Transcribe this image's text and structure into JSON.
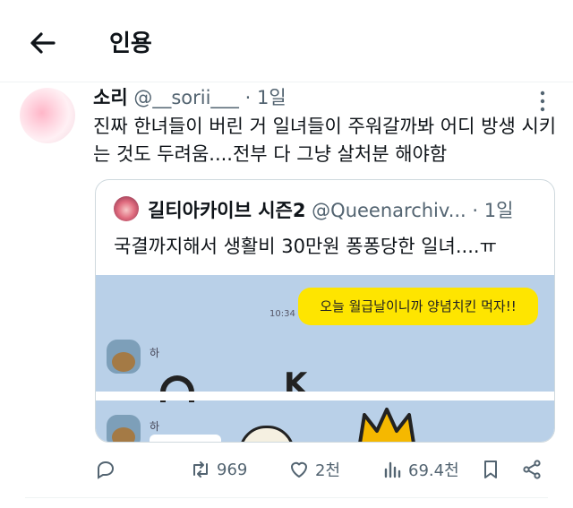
{
  "header": {
    "title": "인용"
  },
  "tweet": {
    "name": "소리",
    "handle": "@__sorii___",
    "dot": "·",
    "time": "1일",
    "text": "진짜 한녀들이 버린 거 일녀들이 주워갈까봐 어디 방생 시키는 것도 두려움....전부 다 그냥 살처분 해야함"
  },
  "quote": {
    "name": "길티아카이브 시즌2",
    "handle": "@Queenarchiv...",
    "dot": "·",
    "time": "1일",
    "text": "국결까지해서 생활비 30만원 퐁퐁당한 일녀....ㅠ",
    "media": {
      "bubble": "오늘 월급날이니까 양념치킨 먹자!!",
      "msg_time": "10:34",
      "chat_name_a": "하",
      "chat_name_b": "하",
      "sticker_text": "K"
    }
  },
  "actions": {
    "reply": "",
    "retweet": "969",
    "like": "2천",
    "views": "69.4천"
  },
  "colors": {
    "icon": "#536471",
    "bubble": "#fee500",
    "chat_bg": "#b9d0e8"
  },
  "icons": [
    "back-arrow-icon",
    "more-icon",
    "reply-icon",
    "retweet-icon",
    "like-icon",
    "views-icon",
    "bookmark-icon",
    "share-icon"
  ]
}
